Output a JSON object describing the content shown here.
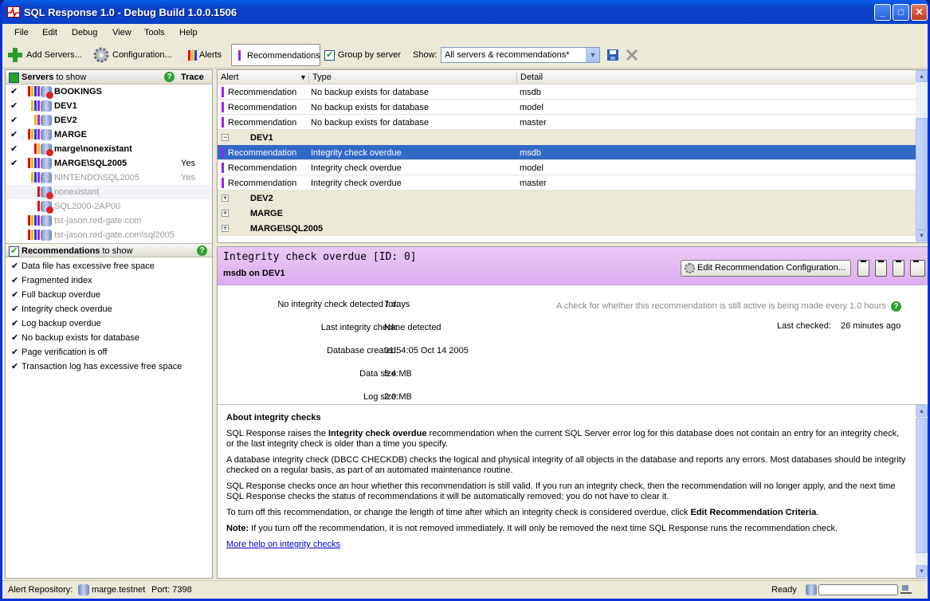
{
  "window": {
    "title": "SQL Response 1.0 - Debug Build 1.0.0.1506"
  },
  "menu": [
    "File",
    "Edit",
    "Debug",
    "View",
    "Tools",
    "Help"
  ],
  "toolbar": {
    "add_servers": "Add Servers...",
    "configuration": "Configuration...",
    "alerts": "Alerts",
    "recommendations": "Recommendations",
    "group_by_server": "Group by server",
    "show_label": "Show:",
    "show_value": "All servers & recommendations*"
  },
  "servers_panel": {
    "title_bold": "Servers",
    "title_rest": " to show",
    "trace_label": "Trace",
    "items": [
      {
        "name": "BOOKINGS",
        "trace": "",
        "checked": true,
        "bold": true,
        "grey": false
      },
      {
        "name": "DEV1",
        "trace": "",
        "checked": true,
        "bold": true,
        "grey": false
      },
      {
        "name": "DEV2",
        "trace": "",
        "checked": true,
        "bold": true,
        "grey": false
      },
      {
        "name": "MARGE",
        "trace": "",
        "checked": true,
        "bold": true,
        "grey": false
      },
      {
        "name": "marge\\nonexistant",
        "trace": "",
        "checked": true,
        "bold": true,
        "grey": false
      },
      {
        "name": "MARGE\\SQL2005",
        "trace": "Yes",
        "checked": true,
        "bold": true,
        "grey": false
      },
      {
        "name": "NINTENDO\\SQL2005",
        "trace": "Yes",
        "checked": false,
        "bold": false,
        "grey": true
      },
      {
        "name": "nonexistant",
        "trace": "",
        "checked": false,
        "bold": false,
        "grey": true
      },
      {
        "name": "SQL2000-2AP00",
        "trace": "",
        "checked": false,
        "bold": false,
        "grey": true
      },
      {
        "name": "tst-jason.red-gate.com",
        "trace": "",
        "checked": false,
        "bold": false,
        "grey": true
      },
      {
        "name": "tst-jason.red-gate.com\\sql2005",
        "trace": "",
        "checked": false,
        "bold": false,
        "grey": true
      }
    ]
  },
  "recommendations_panel": {
    "title_bold": "Recommendations",
    "title_rest": " to show",
    "items": [
      "Data file has excessive free space",
      "Fragmented index",
      "Full backup overdue",
      "Integrity check overdue",
      "Log backup overdue",
      "No backup exists for database",
      "Page verification is off",
      "Transaction log has excessive free space"
    ]
  },
  "grid": {
    "columns": [
      "Alert",
      "Type",
      "Detail"
    ],
    "rows": [
      {
        "kind": "row",
        "alert": "Recommendation",
        "type": "No backup exists for database",
        "detail": "msdb"
      },
      {
        "kind": "row",
        "alert": "Recommendation",
        "type": "No backup exists for database",
        "detail": "model"
      },
      {
        "kind": "row",
        "alert": "Recommendation",
        "type": "No backup exists for database",
        "detail": "master"
      },
      {
        "kind": "group",
        "name": "DEV1",
        "expander": "−"
      },
      {
        "kind": "row",
        "alert": "Recommendation",
        "type": "Integrity check overdue",
        "detail": "msdb",
        "selected": true
      },
      {
        "kind": "row",
        "alert": "Recommendation",
        "type": "Integrity check overdue",
        "detail": "model"
      },
      {
        "kind": "row",
        "alert": "Recommendation",
        "type": "Integrity check overdue",
        "detail": "master"
      },
      {
        "kind": "group",
        "name": "DEV2",
        "expander": "+"
      },
      {
        "kind": "group",
        "name": "MARGE",
        "expander": "+"
      },
      {
        "kind": "group",
        "name": "MARGE\\SQL2005",
        "expander": "+"
      }
    ]
  },
  "detail": {
    "title": "Integrity check overdue [ID: 0]",
    "subtitle": "msdb on DEV1",
    "edit_button": "Edit Recommendation Configuration...",
    "props": [
      {
        "label": "No integrity check detected for:",
        "value": "7 days"
      },
      {
        "label": "Last integrity check:",
        "value": "None detected"
      },
      {
        "label": "Database created:",
        "value": "01:54:05 Oct 14 2005"
      },
      {
        "label": "Data size:",
        "value": "5.4 MB"
      },
      {
        "label": "Log size:",
        "value": "2.0 MB"
      }
    ],
    "check_note": "A check for whether this recommendation is still active is being made every 1.0 hours",
    "last_checked_label": "Last checked:",
    "last_checked_value": "26 minutes ago",
    "about": {
      "heading": "About integrity checks",
      "p1_a": "SQL Response raises the ",
      "p1_b": "Integrity check overdue",
      "p1_c": " recommendation when the current SQL Server error log for this database does not contain an entry for an integrity check, or the last integrity check is older than a time you specify.",
      "p2": "A database integrity check (DBCC CHECKDB) checks the logical and physical integrity of all objects in the database and reports any errors. Most databases should be integrity checked on a regular basis, as part of an automated maintenance routine.",
      "p3": "SQL Response checks once an  hour whether this recommendation is still valid. If you run an integrity check, then the recommendation will no longer apply, and the next time SQL Response checks the status of recommendations it will be automatically removed; you do not have to clear it.",
      "p4_a": "To turn off this recommendation, or change the length of time after which an integrity check is considered overdue, click ",
      "p4_b": "Edit Recommendation Criteria",
      "p4_c": ".",
      "p5_a": "Note:",
      "p5_b": " If you turn off the recommendation, it is not removed immediately. It will only be removed the next time SQL Response runs the recommendation check.",
      "link": "More  help  on  integrity  checks"
    }
  },
  "status": {
    "repo_label": "Alert Repository:",
    "repo_value": "marge.testnet",
    "port": "Port: 7398",
    "state": "Ready"
  },
  "colors": {
    "accent": "#316ac5",
    "recommendation": "#a020f0",
    "detail_header": "#e4bdf4"
  }
}
